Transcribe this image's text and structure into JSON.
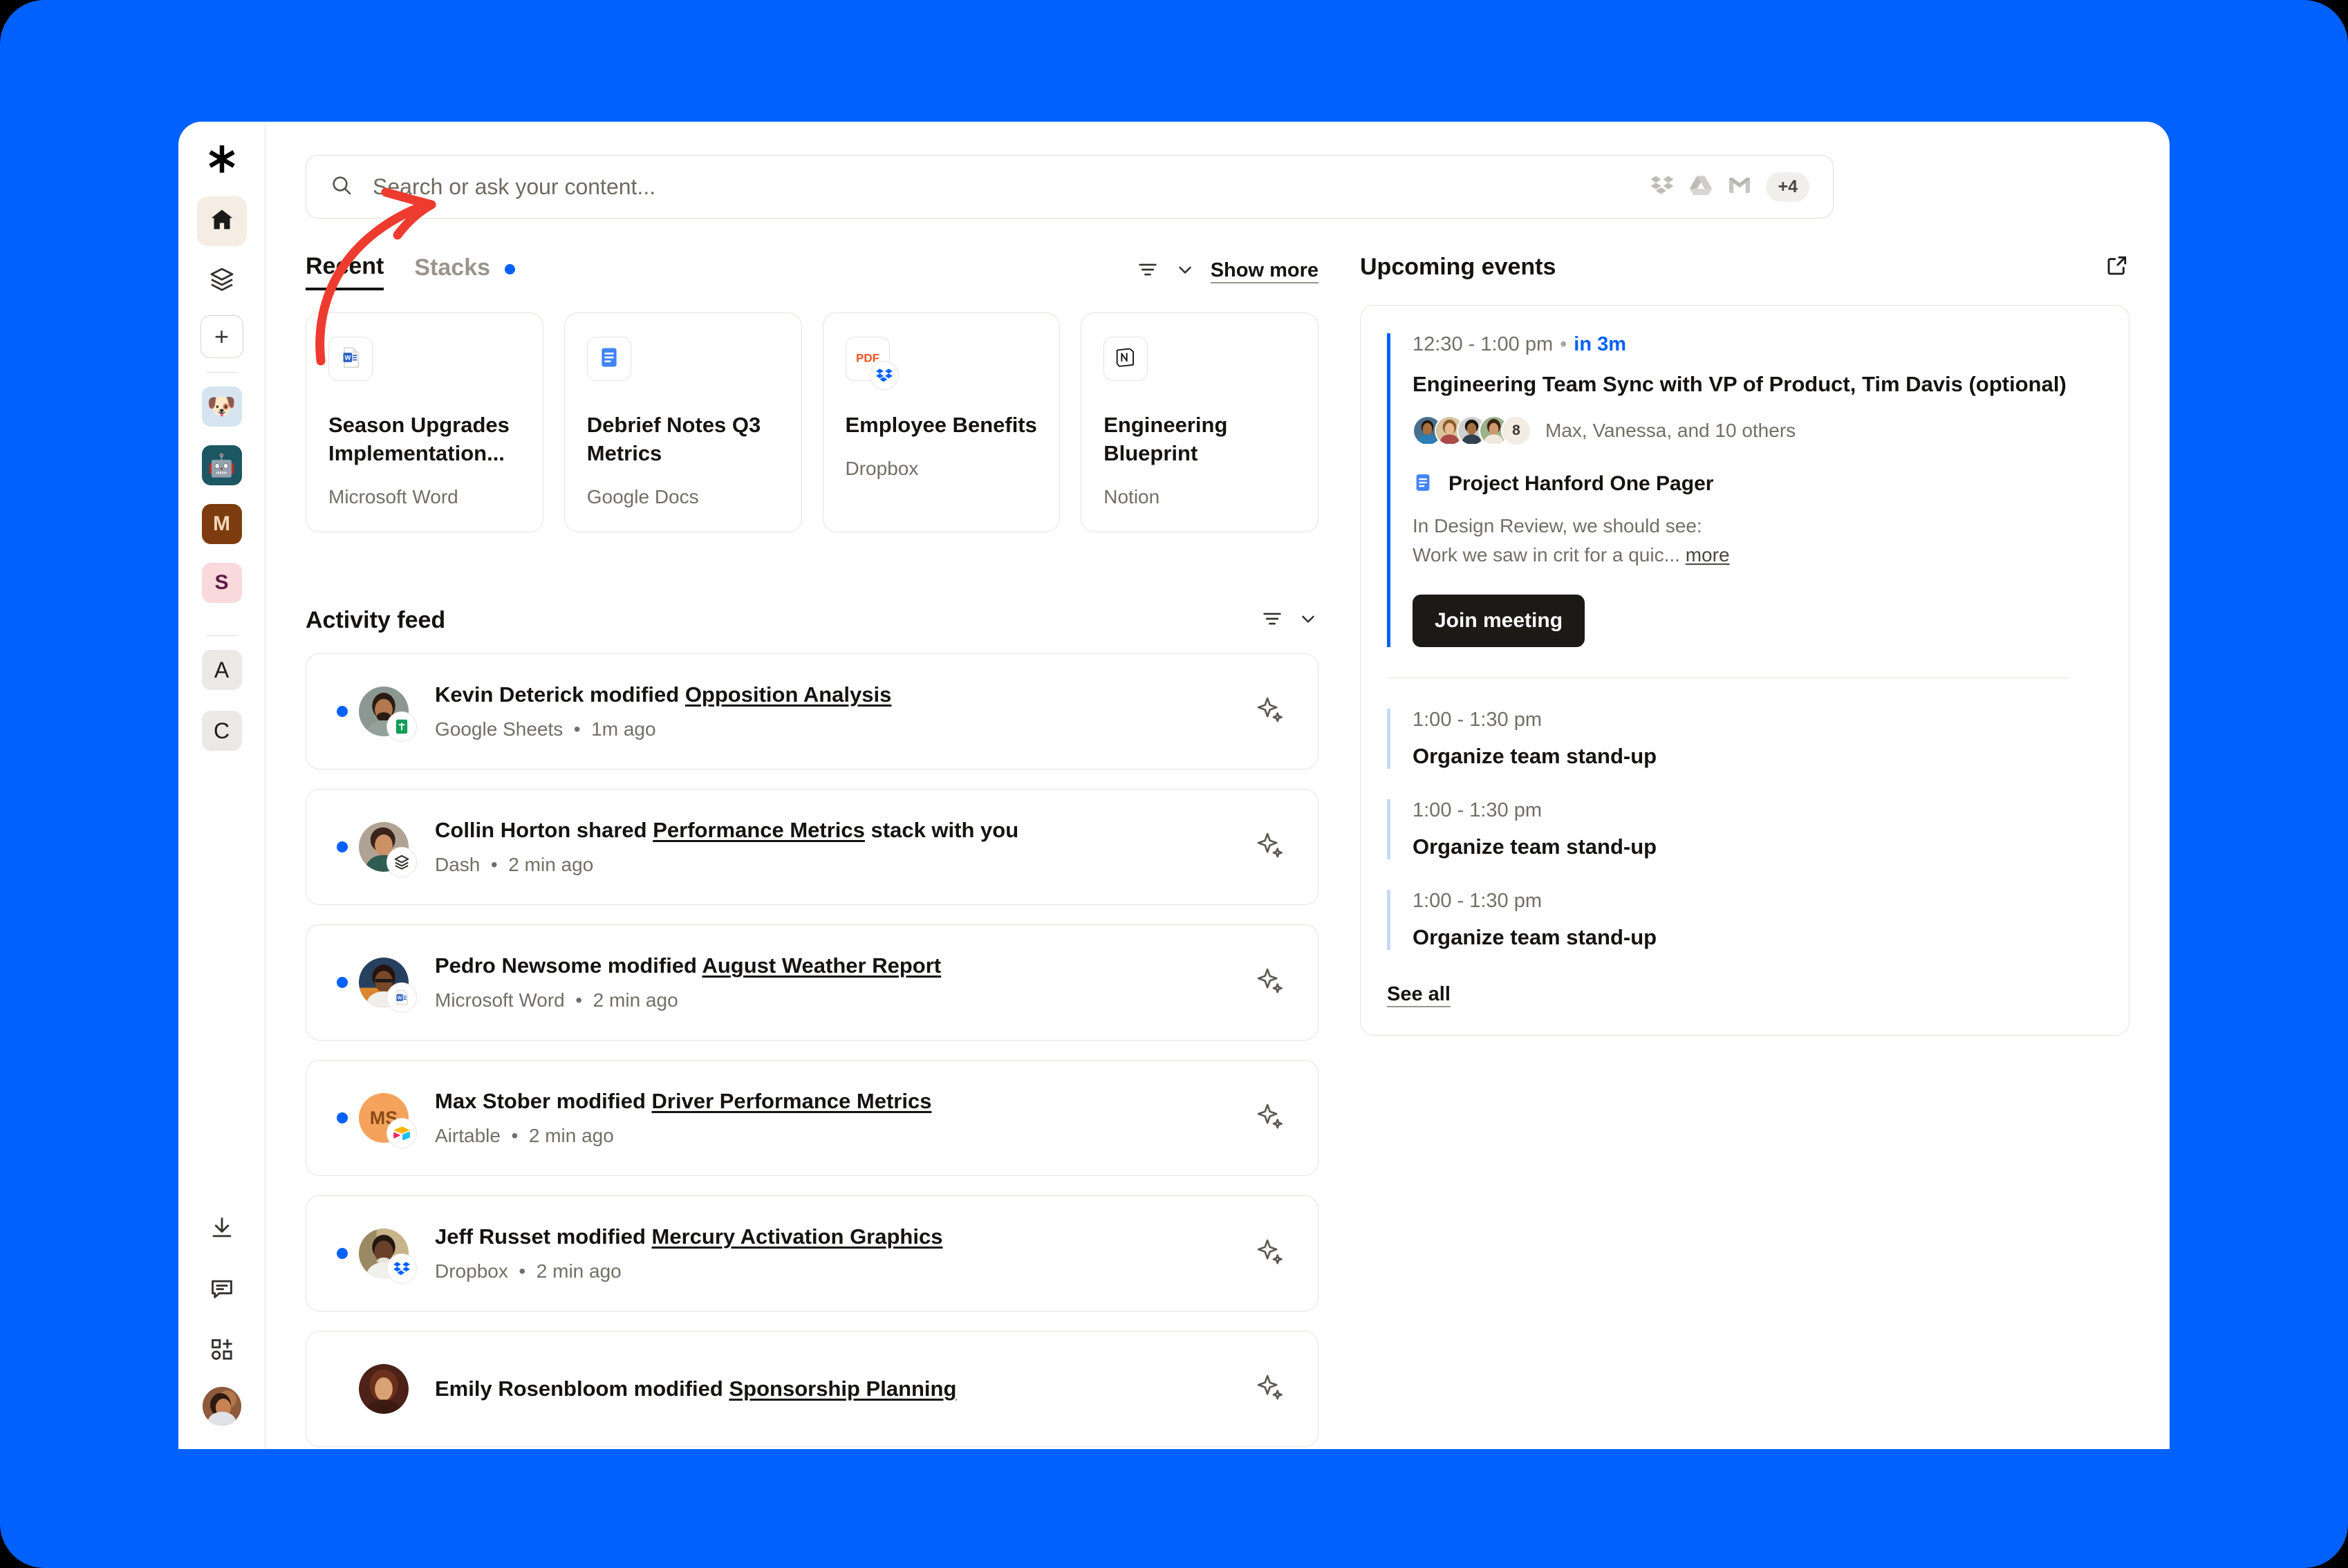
{
  "theme": {
    "brand_blue": "#0061FE",
    "dark": "#1b1a17",
    "muted": "#736e66"
  },
  "rail": {
    "logo": "dropbox-asterisk-logo",
    "items": [
      {
        "name": "home",
        "icon": "home-icon",
        "active": true
      },
      {
        "name": "stacks",
        "icon": "stacks-icon",
        "active": false
      },
      {
        "name": "create",
        "icon": "plus-icon",
        "active": false
      }
    ],
    "apps": [
      {
        "name": "dog-emoji-app",
        "glyph": "🐶",
        "bg": "#d6e4f0"
      },
      {
        "name": "robot-emoji-app",
        "glyph": "🤖",
        "bg": "#1c5763"
      },
      {
        "name": "m-app",
        "glyph": "M",
        "bg": "#7d3c10",
        "fg": "#f5d6b8"
      },
      {
        "name": "s-app",
        "glyph": "S",
        "bg": "#fad9dc",
        "fg": "#5b1b45"
      }
    ],
    "letters": [
      {
        "name": "a-tile",
        "glyph": "A"
      },
      {
        "name": "c-tile",
        "glyph": "C"
      }
    ],
    "bottom": [
      {
        "name": "download",
        "icon": "download-icon"
      },
      {
        "name": "feedback",
        "icon": "chat-bubble-icon"
      },
      {
        "name": "integrations",
        "icon": "apps-grid-plus-icon"
      }
    ],
    "avatar": "user-avatar"
  },
  "search": {
    "placeholder": "Search or ask your content...",
    "value": "",
    "icon": "search-icon",
    "connected_apps": [
      "dropbox-icon",
      "google-drive-icon",
      "gmail-icon"
    ],
    "overflow_badge": "+4"
  },
  "tabs": {
    "items": [
      {
        "label": "Recent",
        "active": true,
        "dot": false
      },
      {
        "label": "Stacks",
        "active": false,
        "dot": true
      }
    ],
    "sort_icon": "sort-icon",
    "chevron_icon": "chevron-down-icon",
    "show_more": "Show more"
  },
  "recent_cards": [
    {
      "title": "Season Upgrades Implementation...",
      "source": "Microsoft Word",
      "icon": "word-icon",
      "badge": null
    },
    {
      "title": "Debrief Notes Q3 Metrics",
      "source": "Google Docs",
      "icon": "google-docs-icon",
      "badge": null
    },
    {
      "title": "Employee Benefits",
      "source": "Dropbox",
      "icon": "pdf-icon",
      "badge": "dropbox-icon"
    },
    {
      "title": "Engineering Blueprint",
      "source": "Notion",
      "icon": "notion-icon",
      "badge": null
    }
  ],
  "activity": {
    "title": "Activity feed",
    "sort_icon": "sort-icon",
    "chevron_icon": "chevron-down-icon",
    "rows": [
      {
        "actor": "Kevin Deterick",
        "verb": "modified",
        "target": "Opposition Analysis",
        "suffix": "",
        "source": "Google Sheets",
        "time": "1m ago",
        "badge": "google-sheets-icon",
        "avatar_type": "photo",
        "avatar_bg": "#7f8a84",
        "unread": true
      },
      {
        "actor": "Collin Horton",
        "verb": "shared",
        "target": "Performance Metrics",
        "suffix": " stack with you",
        "source": "Dash",
        "time": "2 min ago",
        "badge": "stacks-icon",
        "avatar_type": "photo",
        "avatar_bg": "#9b8d7e",
        "unread": true
      },
      {
        "actor": "Pedro Newsome",
        "verb": "modified",
        "target": "August Weather Report",
        "suffix": "",
        "source": "Microsoft Word",
        "time": "2 min ago",
        "badge": "word-icon",
        "avatar_type": "photo",
        "avatar_bg": "#27405f",
        "unread": true
      },
      {
        "actor": "Max Stober",
        "verb": "modified",
        "target": "Driver Performance Metrics",
        "suffix": "",
        "source": "Airtable",
        "time": "2 min ago",
        "badge": "airtable-icon",
        "avatar_type": "initials",
        "avatar_initials": "MS",
        "avatar_bg": "#f5a35c",
        "unread": true
      },
      {
        "actor": "Jeff Russet",
        "verb": "modified",
        "target": "Mercury Activation Graphics",
        "suffix": "",
        "source": "Dropbox",
        "time": "2 min ago",
        "badge": "dropbox-icon",
        "avatar_type": "photo",
        "avatar_bg": "#6b4a36",
        "unread": true
      },
      {
        "actor": "Emily Rosenbloom",
        "verb": "modified",
        "target": "Sponsorship Planning",
        "suffix": "",
        "source": "",
        "time": "",
        "badge": "",
        "avatar_type": "photo",
        "avatar_bg": "#5c2f22",
        "unread": false
      }
    ],
    "sparkle_icon": "sparkle-ai-icon"
  },
  "upcoming": {
    "title": "Upcoming events",
    "expand_icon": "open-external-icon",
    "featured": {
      "time": "12:30 - 1:00 pm",
      "separator": "•",
      "relative": "in 3m",
      "title": "Engineering Team Sync with VP of Product, Tim Davis (optional)",
      "attendee_overflow": "8",
      "attendees_text": "Max, Vanessa, and 10 others",
      "doc_icon": "google-docs-icon",
      "doc_title": "Project Hanford One Pager",
      "description_line1": "In Design Review, we should see:",
      "description_line2": "Work we saw in crit for a quic...",
      "more_label": "more",
      "join_label": "Join meeting"
    },
    "others": [
      {
        "time": "1:00 - 1:30 pm",
        "title": "Organize team stand-up"
      },
      {
        "time": "1:00 - 1:30 pm",
        "title": "Organize team stand-up"
      },
      {
        "time": "1:00 - 1:30 pm",
        "title": "Organize team stand-up"
      }
    ],
    "see_all": "See all"
  },
  "annotation": {
    "type": "red-curved-arrow",
    "points_to": "search-input",
    "color": "#ED3B2F"
  }
}
